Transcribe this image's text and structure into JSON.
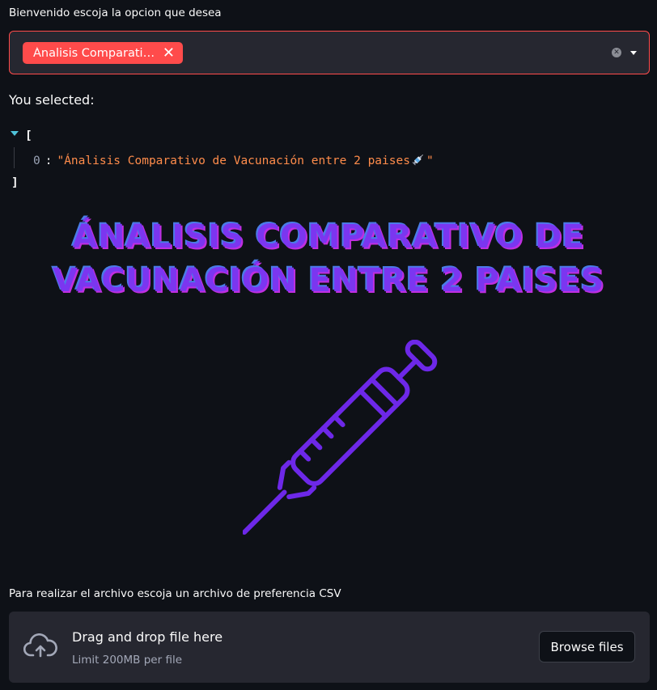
{
  "multiselect": {
    "label": "Bienvenido escoja la opcion que desea",
    "chip_label": "Ánalisis Comparati…",
    "chip_remove_icon": "close-icon",
    "accent_color": "#ff4b4b"
  },
  "selection": {
    "heading": "You selected:",
    "json_open": "[",
    "json_close": "]",
    "items": [
      {
        "index": "0",
        "separator": ":",
        "value_text": "\"Ánalisis Comparativo de Vacunación entre 2 paises",
        "value_end": "\""
      }
    ]
  },
  "headline": {
    "line1": "ÁNALISIS COMPARATIVO DE",
    "line2": "VACUNACIÓN ENTRE 2 PAISES"
  },
  "illustration": {
    "icon": "syringe-icon",
    "color": "#6d28e8"
  },
  "uploader": {
    "label": "Para realizar el archivo escoja un archivo de preferencia CSV",
    "drop_title": "Drag and drop file here",
    "drop_limit": "Limit 200MB per file",
    "browse_label": "Browse files",
    "icon": "cloud-upload-icon"
  }
}
